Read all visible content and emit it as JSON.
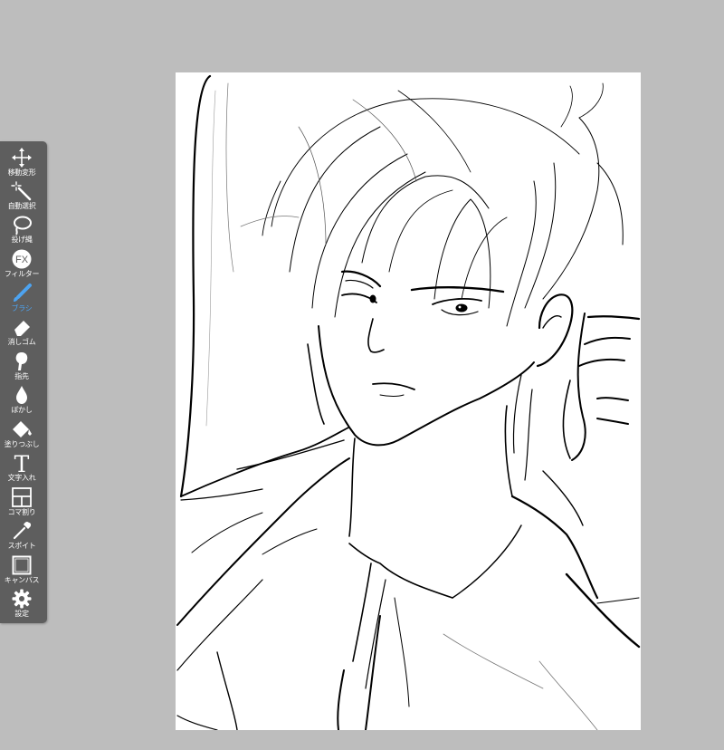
{
  "toolbar": {
    "active_color": "#4da3f0",
    "tools": [
      {
        "label": "移動変形",
        "icon": "move-transform-icon"
      },
      {
        "label": "自動選択",
        "icon": "magic-wand-icon"
      },
      {
        "label": "投げ縄",
        "icon": "lasso-icon"
      },
      {
        "label": "フィルター",
        "icon": "fx-filter-icon",
        "fx_text": "FX"
      },
      {
        "label": "ブラシ",
        "icon": "brush-icon",
        "active": true
      },
      {
        "label": "消しゴム",
        "icon": "eraser-icon"
      },
      {
        "label": "指先",
        "icon": "finger-smudge-icon"
      },
      {
        "label": "ぼかし",
        "icon": "blur-drop-icon"
      },
      {
        "label": "塗りつぶし",
        "icon": "bucket-fill-icon"
      },
      {
        "label": "文字入れ",
        "icon": "text-tool-icon",
        "glyph": "T"
      },
      {
        "label": "コマ割り",
        "icon": "panel-divide-icon"
      },
      {
        "label": "スポイト",
        "icon": "eyedropper-icon"
      },
      {
        "label": "キャンバス",
        "icon": "canvas-icon"
      },
      {
        "label": "設定",
        "icon": "settings-gear-icon"
      }
    ]
  },
  "canvas": {
    "background": "#ffffff",
    "content": "line-art-drawing"
  }
}
